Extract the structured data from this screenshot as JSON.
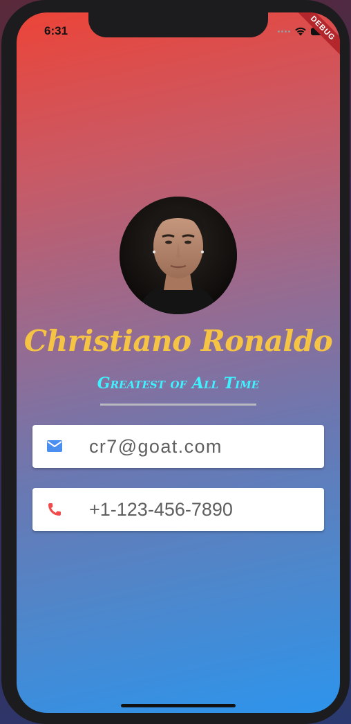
{
  "status_bar": {
    "time": "6:31",
    "debug_banner": "DEBUG"
  },
  "profile": {
    "name": "Christiano Ronaldo",
    "subtitle": "Greatest of All Time"
  },
  "contacts": {
    "email": {
      "value": "cr7@goat.com",
      "icon": "mail-icon",
      "icon_color": "#4a8ef0"
    },
    "phone": {
      "value": "+1-123-456-7890",
      "icon": "phone-icon",
      "icon_color": "#f04a4a"
    }
  },
  "colors": {
    "name": "#f6c445",
    "subtitle": "#3ff2ff",
    "gradient_top": "#ec4438",
    "gradient_bottom": "#2d94ec"
  }
}
